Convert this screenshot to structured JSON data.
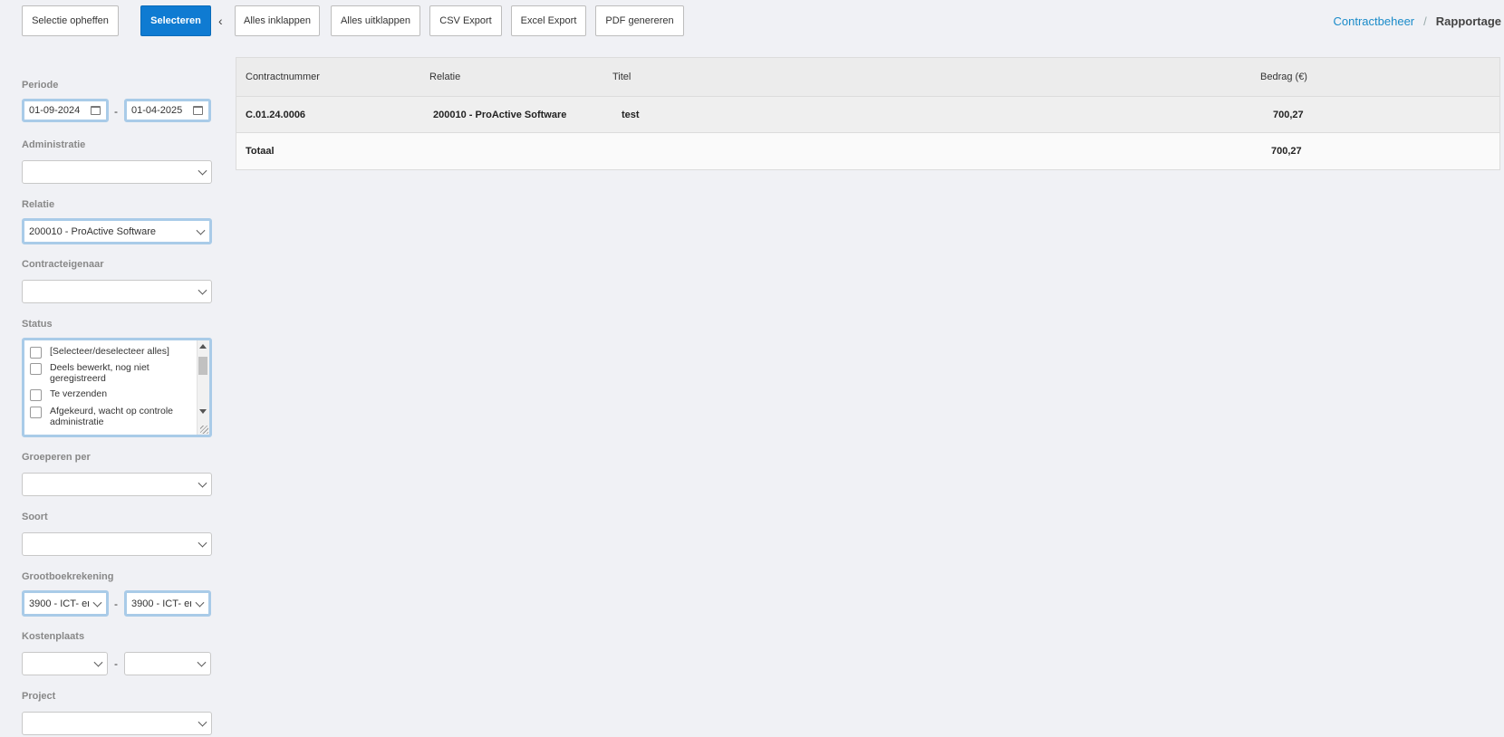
{
  "toolbar": {
    "clear_selection": "Selectie opheffen",
    "select": "Selecteren",
    "collapse_all": "Alles inklappen",
    "expand_all": "Alles uitklappen",
    "csv_export": "CSV Export",
    "excel_export": "Excel Export",
    "pdf_generate": "PDF genereren"
  },
  "breadcrumb": {
    "parent": "Contractbeheer",
    "separator": "/",
    "current": "Rapportage"
  },
  "filters": {
    "periode": {
      "label": "Periode",
      "from": "01-09-2024",
      "to": "01-04-2025",
      "separator": "-"
    },
    "administratie": {
      "label": "Administratie",
      "value": ""
    },
    "relatie": {
      "label": "Relatie",
      "value": "200010 - ProActive Software"
    },
    "contracteigenaar": {
      "label": "Contracteigenaar",
      "value": ""
    },
    "status": {
      "label": "Status",
      "options": [
        "[Selecteer/deselecteer alles]",
        "Deels bewerkt, nog niet geregistreerd",
        "Te verzenden",
        "Afgekeurd, wacht op controle administratie"
      ]
    },
    "groeperen_per": {
      "label": "Groeperen per",
      "value": ""
    },
    "soort": {
      "label": "Soort",
      "value": ""
    },
    "grootboekrekening": {
      "label": "Grootboekrekening",
      "from": "3900 - ICT- en",
      "to": "3900 - ICT- en",
      "separator": "-"
    },
    "kostenplaats": {
      "label": "Kostenplaats",
      "from": "",
      "to": "",
      "separator": "-"
    },
    "project": {
      "label": "Project",
      "value": ""
    }
  },
  "table": {
    "columns": [
      "Contractnummer",
      "Relatie",
      "Titel",
      "Bedrag (€)"
    ],
    "rows": [
      {
        "contractnummer": "C.01.24.0006",
        "relatie": "200010 - ProActive Software",
        "titel": "test",
        "bedrag": "700,27"
      }
    ],
    "total_label": "Totaal",
    "total_value": "700,27"
  },
  "colors": {
    "primary": "#0f7bd2",
    "link": "#1a8bc9",
    "highlight_border": "#a9cbe8",
    "background": "#f0f1f5"
  }
}
